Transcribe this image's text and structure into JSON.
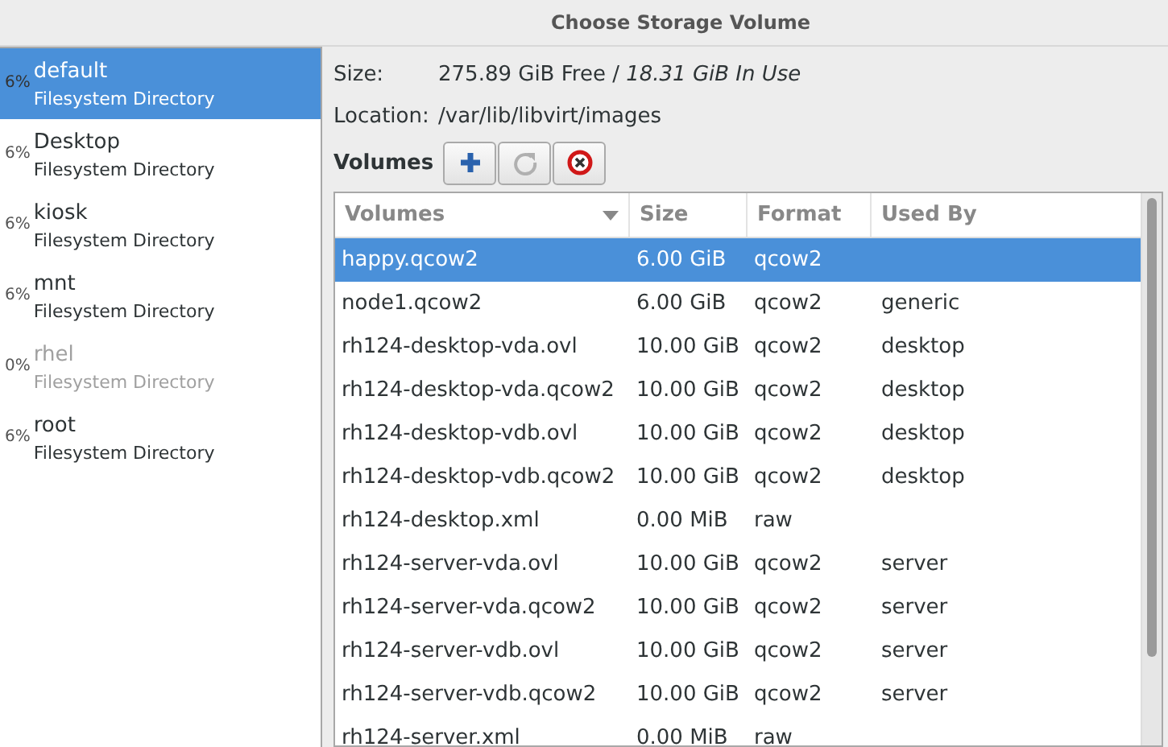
{
  "window": {
    "title": "Choose Storage Volume"
  },
  "pools": [
    {
      "usage": "6%",
      "name": "default",
      "type": "Filesystem Directory",
      "selected": true,
      "disabled": false
    },
    {
      "usage": "6%",
      "name": "Desktop",
      "type": "Filesystem Directory",
      "selected": false,
      "disabled": false
    },
    {
      "usage": "6%",
      "name": "kiosk",
      "type": "Filesystem Directory",
      "selected": false,
      "disabled": false
    },
    {
      "usage": "6%",
      "name": "mnt",
      "type": "Filesystem Directory",
      "selected": false,
      "disabled": false
    },
    {
      "usage": "0%",
      "name": "rhel",
      "type": "Filesystem Directory",
      "selected": false,
      "disabled": true
    },
    {
      "usage": "6%",
      "name": "root",
      "type": "Filesystem Directory",
      "selected": false,
      "disabled": false
    }
  ],
  "details": {
    "size_label": "Size:",
    "size_free": "275.89 GiB Free / ",
    "size_used": "18.31 GiB In Use",
    "location_label": "Location:",
    "location": "/var/lib/libvirt/images"
  },
  "volumes_label": "Volumes",
  "table": {
    "columns": [
      "Volumes",
      "Size",
      "Format",
      "Used By"
    ],
    "rows": [
      {
        "name": "happy.qcow2",
        "size": "6.00 GiB",
        "format": "qcow2",
        "used_by": "",
        "selected": true
      },
      {
        "name": "node1.qcow2",
        "size": "6.00 GiB",
        "format": "qcow2",
        "used_by": "generic",
        "selected": false
      },
      {
        "name": "rh124-desktop-vda.ovl",
        "size": "10.00 GiB",
        "format": "qcow2",
        "used_by": "desktop",
        "selected": false
      },
      {
        "name": "rh124-desktop-vda.qcow2",
        "size": "10.00 GiB",
        "format": "qcow2",
        "used_by": "desktop",
        "selected": false
      },
      {
        "name": "rh124-desktop-vdb.ovl",
        "size": "10.00 GiB",
        "format": "qcow2",
        "used_by": "desktop",
        "selected": false
      },
      {
        "name": "rh124-desktop-vdb.qcow2",
        "size": "10.00 GiB",
        "format": "qcow2",
        "used_by": "desktop",
        "selected": false
      },
      {
        "name": "rh124-desktop.xml",
        "size": "0.00 MiB",
        "format": "raw",
        "used_by": "",
        "selected": false
      },
      {
        "name": "rh124-server-vda.ovl",
        "size": "10.00 GiB",
        "format": "qcow2",
        "used_by": "server",
        "selected": false
      },
      {
        "name": "rh124-server-vda.qcow2",
        "size": "10.00 GiB",
        "format": "qcow2",
        "used_by": "server",
        "selected": false
      },
      {
        "name": "rh124-server-vdb.ovl",
        "size": "10.00 GiB",
        "format": "qcow2",
        "used_by": "server",
        "selected": false
      },
      {
        "name": "rh124-server-vdb.qcow2",
        "size": "10.00 GiB",
        "format": "qcow2",
        "used_by": "server",
        "selected": false
      },
      {
        "name": "rh124-server.xml",
        "size": "0.00 MiB",
        "format": "raw",
        "used_by": "",
        "selected": false
      }
    ]
  }
}
